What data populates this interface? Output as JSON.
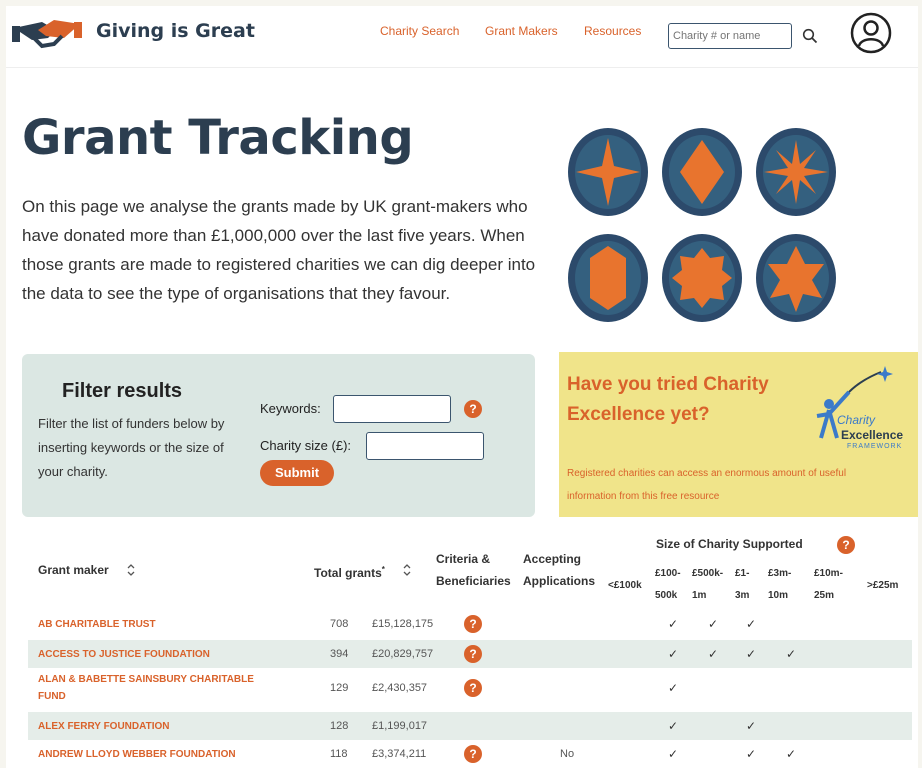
{
  "header": {
    "brand": "Giving is Great",
    "nav": [
      "Charity Search",
      "Grant Makers",
      "Resources"
    ],
    "search_placeholder": "Charity # or name"
  },
  "hero": {
    "title": "Grant Tracking",
    "intro": "On this page we analyse the grants made by UK grant-makers who have donated more than £1,000,000 over the last five years. When those grants are made to registered charities we can dig deeper into the data to see the type of organisations that they favour."
  },
  "filter": {
    "title": "Filter results",
    "description": "Filter the list of funders below by inserting keywords or the size of your charity.",
    "keywords_label": "Keywords:",
    "size_label": "Charity size (£):",
    "submit_label": "Submit",
    "help_glyph": "?"
  },
  "promo": {
    "title": "Have you tried Charity Excellence yet?",
    "text": "Registered charities can access an enormous amount of useful information from this free resource",
    "logo_line1": "Charity",
    "logo_line2": "Excellence",
    "logo_line3": "FRAMEWORK"
  },
  "table": {
    "headers": {
      "grant_maker": "Grant maker",
      "total_grants": "Total grants",
      "total_grants_mark": "*",
      "criteria_line1": "Criteria &",
      "criteria_line2": "Beneficiaries",
      "accepting_line1": "Accepting",
      "accepting_line2": "Applications",
      "size_group": "Size of Charity Supported",
      "sizes": [
        {
          "l1": "<£100k",
          "l2": ""
        },
        {
          "l1": "£100-",
          "l2": "500k"
        },
        {
          "l1": "£500k-",
          "l2": "1m"
        },
        {
          "l1": "£1-",
          "l2": "3m"
        },
        {
          "l1": "£3m-",
          "l2": "10m"
        },
        {
          "l1": "£10m-",
          "l2": "25m"
        },
        {
          "l1": ">£25m",
          "l2": ""
        }
      ]
    },
    "rows": [
      {
        "name_l1": "AB CHARITABLE TRUST",
        "name_l2": "",
        "count": "708",
        "total": "£15,128,175",
        "help": true,
        "accepting": "",
        "ticks": [
          "",
          "✓",
          "✓",
          "✓",
          "",
          "",
          ""
        ]
      },
      {
        "name_l1": "ACCESS TO JUSTICE FOUNDATION",
        "name_l2": "",
        "count": "394",
        "total": "£20,829,757",
        "help": true,
        "accepting": "",
        "ticks": [
          "",
          "✓",
          "✓",
          "✓",
          "✓",
          "",
          ""
        ]
      },
      {
        "name_l1": "ALAN & BABETTE SAINSBURY CHARITABLE",
        "name_l2": "FUND",
        "count": "129",
        "total": "£2,430,357",
        "help": true,
        "accepting": "",
        "ticks": [
          "",
          "✓",
          "",
          "",
          "",
          "",
          ""
        ]
      },
      {
        "name_l1": "ALEX FERRY FOUNDATION",
        "name_l2": "",
        "count": "128",
        "total": "£1,199,017",
        "help": false,
        "accepting": "",
        "ticks": [
          "",
          "✓",
          "",
          "✓",
          "",
          "",
          ""
        ]
      },
      {
        "name_l1": "ANDREW LLOYD WEBBER FOUNDATION",
        "name_l2": "",
        "count": "118",
        "total": "£3,374,211",
        "help": true,
        "accepting": "No",
        "ticks": [
          "",
          "✓",
          "",
          "✓",
          "✓",
          "",
          ""
        ]
      }
    ]
  }
}
